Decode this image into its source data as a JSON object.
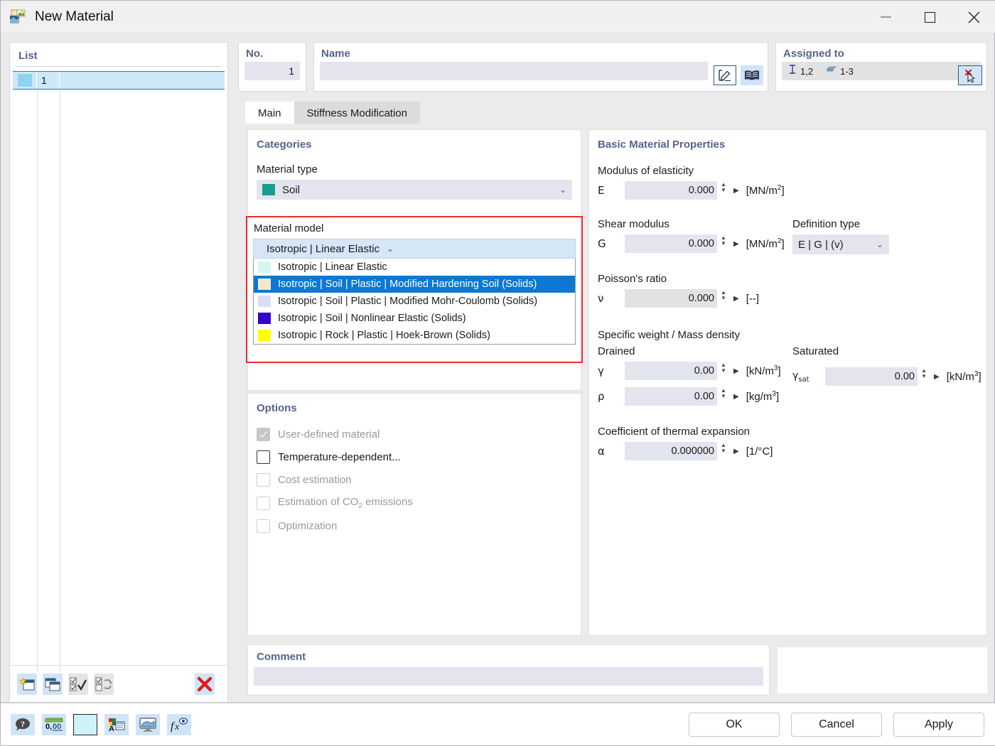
{
  "window": {
    "title": "New Material",
    "icon": "material-icon",
    "minimize": "minimize-icon",
    "maximize": "maximize-icon",
    "close": "close-icon"
  },
  "list_panel": {
    "header": "List",
    "rows": [
      {
        "number": "1",
        "color": "#8cd3f0",
        "name": ""
      }
    ],
    "toolbar": [
      {
        "name": "new-material-button",
        "icon": "new-window-icon"
      },
      {
        "name": "copy-material-button",
        "icon": "copy-window-icon"
      },
      {
        "name": "select-all-button",
        "icon": "check-all-icon"
      },
      {
        "name": "invert-selection-button",
        "icon": "invert-check-icon"
      },
      {
        "name": "delete-material-button",
        "icon": "red-x-icon"
      }
    ]
  },
  "header_fields": {
    "no_label": "No.",
    "no_value": "1",
    "name_label": "Name",
    "name_value": "",
    "name_placeholder": "",
    "edit_icon": "pencil-edit-icon",
    "library_icon": "book-library-icon",
    "assigned_label": "Assigned to",
    "assigned_items": [
      {
        "icon": "member-icon",
        "value": "1,2"
      },
      {
        "icon": "solid-icon",
        "value": "1-3"
      }
    ],
    "assigned_delete_icon": "delete-cursor-icon"
  },
  "tabs": [
    {
      "label": "Main",
      "active": true
    },
    {
      "label": "Stiffness Modification",
      "active": false
    }
  ],
  "categories": {
    "header": "Categories",
    "material_type_label": "Material type",
    "material_type_value": "Soil",
    "material_type_color": "#15a08d",
    "material_model_label": "Material model",
    "material_model_value": "Isotropic | Linear Elastic",
    "material_model_color": "#d4f5f2",
    "highlight_color": "#ee2b2b",
    "dropdown_options": [
      {
        "label": "Isotropic | Linear Elastic",
        "color": "#d4f5f2",
        "selected": false
      },
      {
        "label": "Isotropic | Soil | Plastic | Modified Hardening Soil (Solids)",
        "color": "#f6e7cc",
        "selected": true
      },
      {
        "label": "Isotropic | Soil | Plastic | Modified Mohr-Coulomb (Solids)",
        "color": "#dddcf5",
        "selected": false
      },
      {
        "label": "Isotropic | Soil | Nonlinear Elastic (Solids)",
        "color": "#3300cc",
        "selected": false
      },
      {
        "label": "Isotropic | Rock | Plastic | Hoek-Brown (Solids)",
        "color": "#ffff00",
        "selected": false
      }
    ]
  },
  "options": {
    "header": "Options",
    "items": [
      {
        "label": "User-defined material",
        "checked": true,
        "enabled": false
      },
      {
        "label": "Temperature-dependent...",
        "checked": false,
        "enabled": true
      },
      {
        "label": "Cost estimation",
        "checked": false,
        "enabled": false
      },
      {
        "label": "Estimation of CO2 emissions",
        "checked": false,
        "enabled": false
      },
      {
        "label": "Optimization",
        "checked": false,
        "enabled": false
      }
    ]
  },
  "properties": {
    "header": "Basic Material Properties",
    "modulus_group": "Modulus of elasticity",
    "modulus_symbol": "E",
    "modulus_value": "0.000",
    "modulus_unit": "[MN/m2]",
    "shear_group": "Shear modulus",
    "shear_symbol": "G",
    "shear_value": "0.000",
    "shear_unit": "[MN/m2]",
    "definition_type_label": "Definition type",
    "definition_type_value": "E | G | (v)",
    "poisson_group": "Poisson's ratio",
    "poisson_symbol": "ν",
    "poisson_value": "0.000",
    "poisson_unit": "[--]",
    "weight_group": "Specific weight / Mass density",
    "drained_label": "Drained",
    "saturated_label": "Saturated",
    "gamma_symbol": "γ",
    "gamma_value": "0.00",
    "gamma_unit": "[kN/m3]",
    "rho_symbol": "ρ",
    "rho_value": "0.00",
    "rho_unit": "[kg/m3]",
    "gamma_sat_symbol": "γsat",
    "gamma_sat_value": "0.00",
    "gamma_sat_unit": "[kN/m3]",
    "thermal_group": "Coefficient of thermal expansion",
    "alpha_symbol": "α",
    "alpha_value": "0.000000",
    "alpha_unit": "[1/°C]"
  },
  "comment": {
    "header": "Comment",
    "value": "",
    "placeholder": ""
  },
  "bottom_bar": {
    "tools": [
      {
        "name": "help-button",
        "icon": "question-balloon-icon"
      },
      {
        "name": "units-button",
        "icon": "decimal-places-icon"
      },
      {
        "name": "color-swatch-button",
        "icon": "color-swatch-icon",
        "color": "#cdf3f8"
      },
      {
        "name": "display-properties-button",
        "icon": "palette-window-icon"
      },
      {
        "name": "visualization-button",
        "icon": "monitor-icon"
      },
      {
        "name": "formula-button",
        "icon": "fx-eye-icon"
      }
    ],
    "buttons": [
      {
        "name": "ok-button",
        "label": "OK"
      },
      {
        "name": "cancel-button",
        "label": "Cancel"
      },
      {
        "name": "apply-button",
        "label": "Apply"
      }
    ]
  }
}
